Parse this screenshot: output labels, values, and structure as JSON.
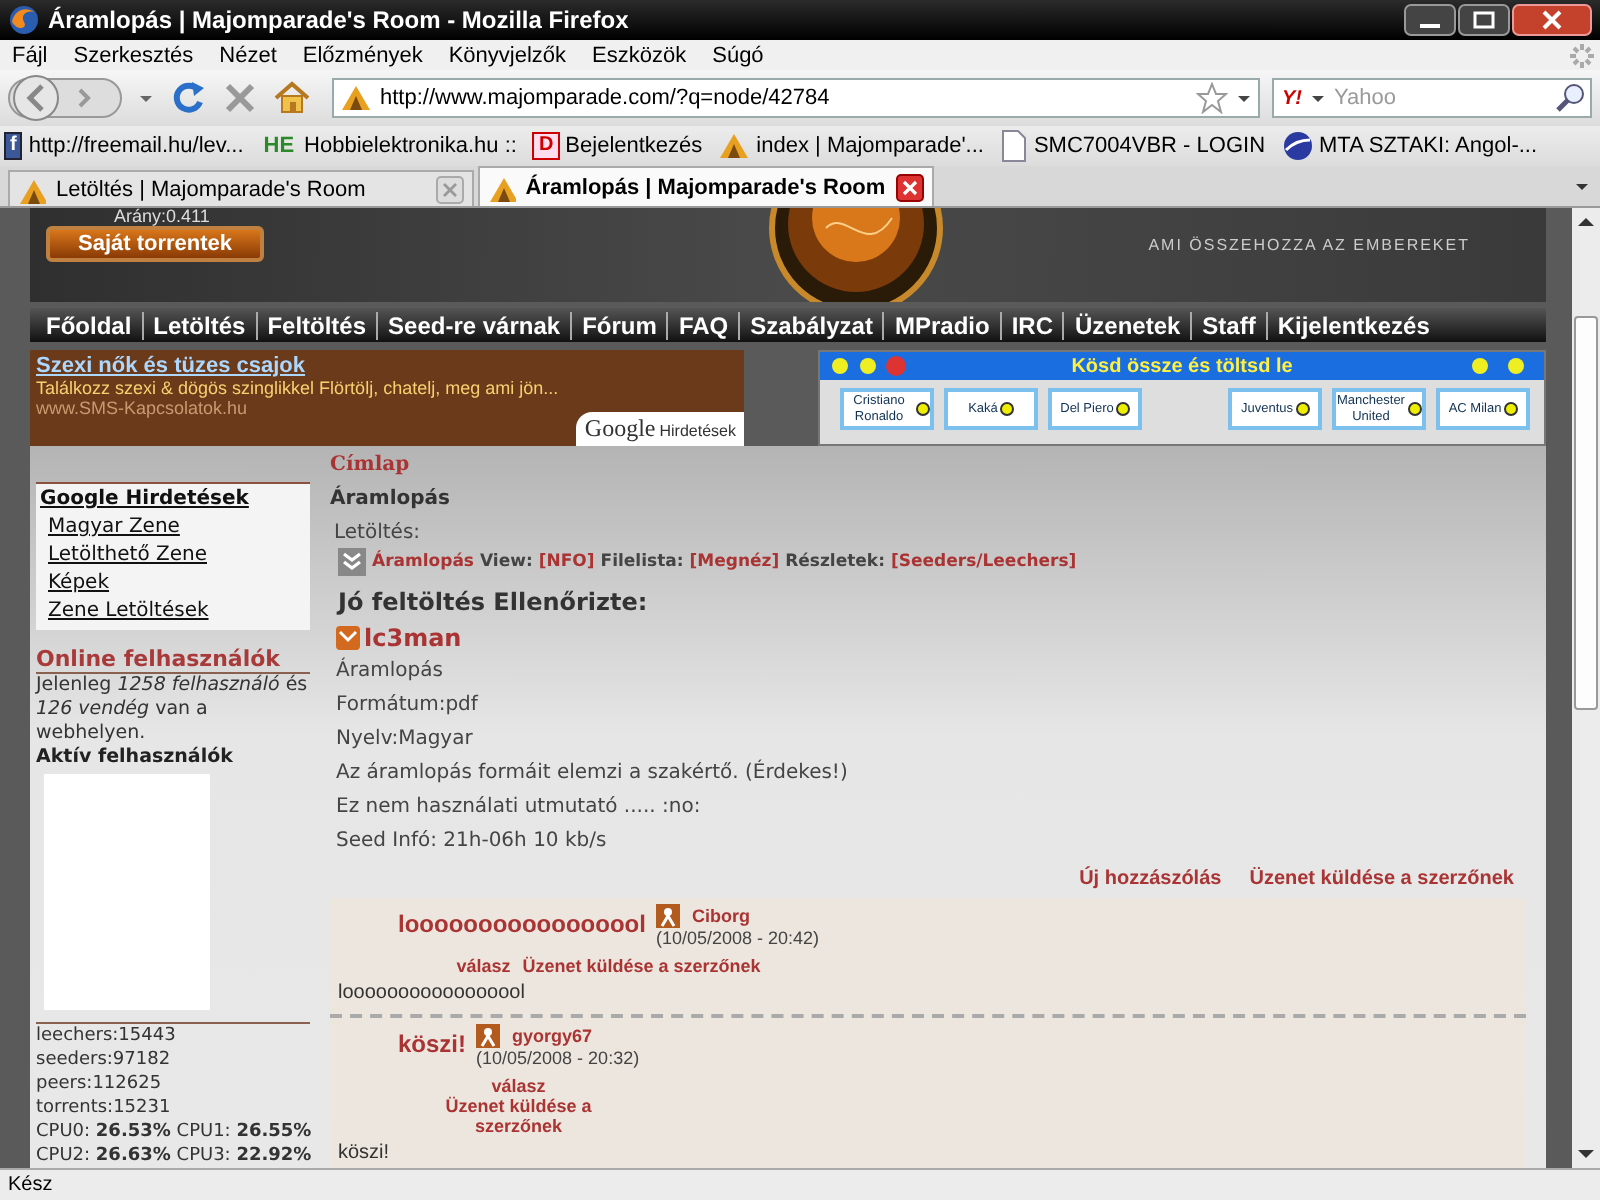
{
  "window": {
    "title": "Áramlopás | Majomparade's Room - Mozilla Firefox"
  },
  "menu": [
    "Fájl",
    "Szerkesztés",
    "Nézet",
    "Előzmények",
    "Könyvjelzők",
    "Eszközök",
    "Súgó"
  ],
  "address": {
    "url": "http://www.majomparade.com/?q=node/42784"
  },
  "search": {
    "engine": "Y!",
    "placeholder": "Yahoo"
  },
  "bookmarks": [
    {
      "kind": "letter",
      "badge": "f",
      "label": "http://freemail.hu/lev..."
    },
    {
      "kind": "text",
      "badge": "HE",
      "label": "Hobbielektronika.hu ::"
    },
    {
      "kind": "letter-red",
      "badge": "D",
      "label": "Bejelentkezés"
    },
    {
      "kind": "site",
      "label": "index | Majomparade'..."
    },
    {
      "kind": "page",
      "label": "SMC7004VBR - LOGIN"
    },
    {
      "kind": "globe",
      "label": "MTA SZTAKI: Angol-..."
    }
  ],
  "tabs": [
    {
      "label": "Letöltés | Majomparade's Room",
      "selected": false
    },
    {
      "label": "Áramlopás | Majomparade's Room",
      "selected": true
    }
  ],
  "header": {
    "ratio": "Arány:0.411",
    "button": "Saját torrentek",
    "slogan": "AMI ÖSSZEHOZZA AZ EMBEREKET"
  },
  "nav": [
    "Főoldal",
    "Letöltés",
    "Feltöltés",
    "Seed-re várnak",
    "Fórum",
    "FAQ",
    "Szabályzat",
    "MPradio",
    "IRC",
    "Üzenetek",
    "Staff",
    "Kijelentkezés"
  ],
  "ad": {
    "title": "Szexi nők és tüzes csajok",
    "text": "Találkozz szexi & dögös szinglikkel Flörtölj, chatelj, meg ami jön...",
    "url": "www.SMS-Kapcsolatok.hu",
    "brand": "Google",
    "brand_label": "Hirdetések"
  },
  "widget": {
    "title": "Kösd össze és töltsd le",
    "players": [
      "Cristiano Ronaldo",
      "Kaká",
      "Del Piero",
      "Juventus",
      "Manchester United",
      "AC Milan"
    ]
  },
  "sidebar": {
    "ads_title": "Google Hirdetések",
    "ads_links": [
      "Magyar Zene",
      "Letölthető Zene",
      "Képek",
      "Zene Letöltések"
    ],
    "online_title": "Online felhasználók",
    "online_text": "Jelenleg *1258 felhasználó* és *126 vendég* van a webhelyen.",
    "active_title": "Aktív felhasználók",
    "stats": [
      "leechers:15443",
      "seeders:97182",
      "peers:112625",
      "torrents:15231"
    ],
    "cpu": [
      "CPU0: **26.53%** CPU1: **26.55%**",
      "CPU2: **26.63%** CPU3: **22.92%**"
    ]
  },
  "content": {
    "breadcrumb": "Címlap",
    "title": "Áramlopás",
    "download_label": "Letöltés:",
    "download_items": [
      {
        "kind": "link",
        "text": "Áramlopás"
      },
      {
        "kind": "label",
        "text": "View:"
      },
      {
        "kind": "link",
        "text": "[NFO]"
      },
      {
        "kind": "label",
        "text": "Filelista:"
      },
      {
        "kind": "link",
        "text": "[Megnéz]"
      },
      {
        "kind": "label",
        "text": "Részletek:"
      },
      {
        "kind": "link",
        "text": "[Seeders/Leechers]"
      }
    ],
    "checked_by": "Jó feltöltés Ellenőrizte:",
    "checker": "lc3man",
    "body": [
      "Áramlopás",
      "Formátum:pdf",
      "Nyelv:Magyar",
      "Az áramlopás formáit elemzi a szakértő. (Érdekes!)",
      "Ez nem használati utmutató ..... :no:",
      "Seed Infó: 21h-06h 10 kb/s"
    ],
    "actions": [
      "Új hozzászólás",
      "Üzenet küldése a szerzőnek"
    ]
  },
  "comments": [
    {
      "subject": "looooooooooooooool",
      "author": "Ciborg",
      "date": "(10/05/2008 - 20:42)",
      "actions": [
        "válasz",
        "Üzenet küldése a szerzőnek"
      ],
      "body": "looooooooooooooool"
    },
    {
      "subject": "köszi!",
      "author": "gyorgy67",
      "date": "(10/05/2008 - 20:32)",
      "actions": [
        "válasz",
        "Üzenet küldése a szerzőnek"
      ],
      "body": "köszi!"
    }
  ],
  "status_bar": "Kész"
}
